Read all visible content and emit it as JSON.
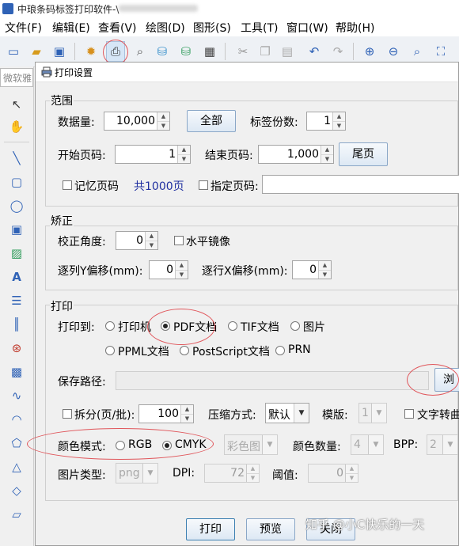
{
  "app": {
    "title": "中琅条码标签打印软件-\\"
  },
  "menu": [
    "文件(F)",
    "编辑(E)",
    "查看(V)",
    "绘图(D)",
    "图形(S)",
    "工具(T)",
    "窗口(W)",
    "帮助(H)"
  ],
  "toolbar": {
    "icons": [
      "window-icon",
      "open-folder-icon",
      "save-icon",
      "gear-icon",
      "print-icon",
      "print-preview-icon",
      "database-icon",
      "database-add-icon",
      "grid-icon",
      "cut-icon",
      "copy-icon",
      "paste-icon",
      "undo-icon",
      "redo-icon",
      "zoom-in-icon",
      "zoom-out-icon",
      "zoom-fit-icon",
      "fullscreen-icon"
    ]
  },
  "left_panel": {
    "tab_label": "微软雅",
    "tools": [
      "pointer-icon",
      "pan-icon",
      "line-icon",
      "rectangle-icon",
      "ellipse-icon",
      "image-icon",
      "picture-icon",
      "text-icon",
      "rich-text-icon",
      "barcode-icon",
      "qrcode-icon",
      "datamatrix-icon",
      "curve-icon",
      "arc-icon",
      "polygon-icon",
      "triangle-icon",
      "diamond-icon",
      "parallelogram-icon"
    ]
  },
  "dialog": {
    "title": "打印设置",
    "range": {
      "group_label": "范围",
      "data_count_label": "数据量:",
      "data_count": "10,000",
      "all_button": "全部",
      "copies_label": "标签份数:",
      "copies": "1",
      "start_page_label": "开始页码:",
      "start_page": "1",
      "end_page_label": "结束页码:",
      "end_page": "1,000",
      "last_page_button": "尾页",
      "remember_page_label": "记忆页码",
      "total_pages_text": "共1000页",
      "specify_page_label": "指定页码:",
      "specify_page_value": ""
    },
    "correction": {
      "group_label": "矫正",
      "angle_label": "校正角度:",
      "angle": "0",
      "mirror_label": "水平镜像",
      "y_offset_label": "逐列Y偏移(mm):",
      "y_offset": "0",
      "x_offset_label": "逐行X偏移(mm):",
      "x_offset": "0"
    },
    "print": {
      "group_label": "打印",
      "print_to_label": "打印到:",
      "targets": [
        "打印机",
        "PDF文档",
        "TIF文档",
        "图片",
        "PPML文档",
        "PostScript文档",
        "PRN"
      ],
      "selected_target": "PDF文档",
      "save_path_label": "保存路径:",
      "save_path": "",
      "browse_button": "浏",
      "split_label": "拆分(页/批):",
      "split_value": "100",
      "compress_label": "压缩方式:",
      "compress_value": "默认",
      "template_label": "模版:",
      "template_value": "1",
      "text_convert_label": "文字转曲",
      "color_mode_label": "颜色模式:",
      "color_modes": [
        "RGB",
        "CMYK"
      ],
      "selected_color_mode": "CMYK",
      "color_image_value": "彩色图",
      "color_count_label": "颜色数量:",
      "color_count": "4",
      "bpp_label": "BPP:",
      "bpp": "2",
      "image_type_label": "图片类型:",
      "image_type": "png",
      "dpi_label": "DPI:",
      "dpi": "72",
      "threshold_label": "阈值:",
      "threshold": "0"
    },
    "buttons": {
      "print": "打印",
      "preview": "预览",
      "close": "关闭"
    }
  },
  "watermark": "知乎 @小C快乐的一天",
  "colors": {
    "annotation": "#e0565b",
    "accent_text": "#2030a0"
  }
}
